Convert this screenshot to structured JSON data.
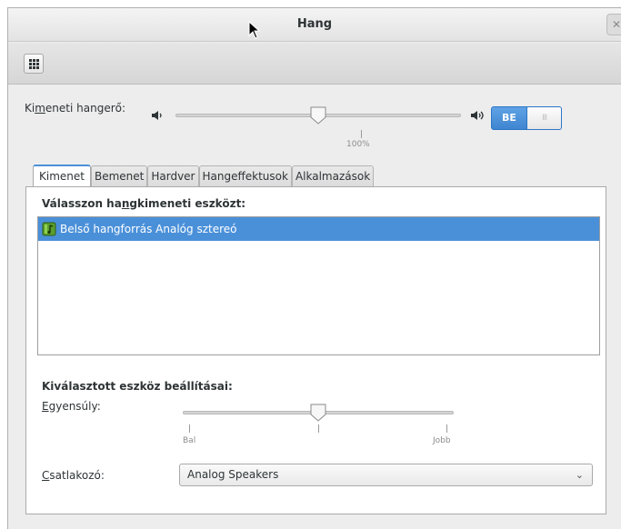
{
  "window": {
    "title": "Hang"
  },
  "toolbar": {
    "grid_button": "apps-grid-icon"
  },
  "volume": {
    "label_pre": "Ki",
    "label_u": "m",
    "label_post": "eneti hangerő:",
    "level_percent": 50,
    "mark_label": "100%",
    "switch_on": "BE",
    "switch_thumb": "III"
  },
  "tabs": [
    "Kimenet",
    "Bemenet",
    "Hardver",
    "Hangeffektusok",
    "Alkalmazások"
  ],
  "output": {
    "choose_pre": "Válasszon ha",
    "choose_u": "n",
    "choose_post": "gkimeneti eszközt:",
    "devices": [
      {
        "name": "Belső hangforrás Analóg sztereó",
        "selected": true
      }
    ]
  },
  "settings": {
    "title": "Kiválasztott eszköz beállításai:",
    "balance_u": "E",
    "balance_rest": "gyensúly:",
    "balance_left": "Bal",
    "balance_right": "Jobb",
    "balance_value": 0.5,
    "connector_u": "C",
    "connector_rest": "satlakozó:",
    "connector_value": "Analog Speakers"
  },
  "colors": {
    "accent": "#4a90d9",
    "selection_text": "#ffffff"
  }
}
